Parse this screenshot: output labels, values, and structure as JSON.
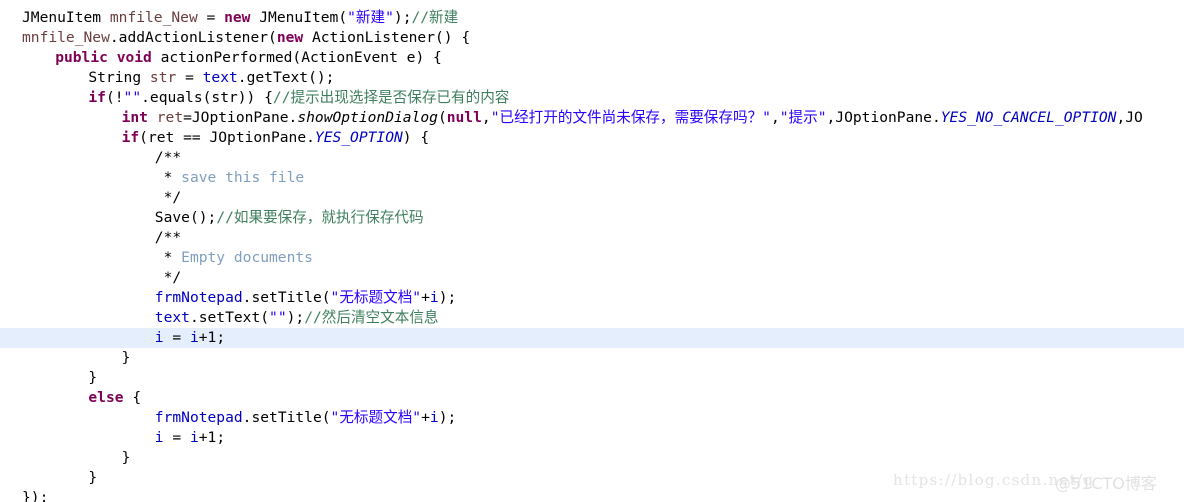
{
  "editor": {
    "language": "Java",
    "background_color": "#ffffff",
    "highlight_color": "#e4eefc",
    "font_size_px": 14.6,
    "line_height_px": 20,
    "highlighted_line_index": 16,
    "colors": {
      "plain": "#000000",
      "keyword": "#7f0055",
      "string": "#2a00ff",
      "comment": "#3f7f5f",
      "javadoc": "#3f5fbf",
      "javadoc_keyword": "#7f9fbf",
      "field": "#0000c0",
      "static_field": "#0000c0",
      "local_variable": "#6a3e3e"
    },
    "lines": [
      {
        "indent": 0,
        "tokens": [
          {
            "t": "JMenuItem ",
            "c": "plain"
          },
          {
            "t": "mnfile_New ",
            "c": "local"
          },
          {
            "t": "= ",
            "c": "plain"
          },
          {
            "t": "new ",
            "c": "keyword"
          },
          {
            "t": "JMenuItem(",
            "c": "plain"
          },
          {
            "t": "\"新建\"",
            "c": "string"
          },
          {
            "t": ");",
            "c": "plain"
          },
          {
            "t": "//新建",
            "c": "comment"
          }
        ]
      },
      {
        "indent": 0,
        "tokens": [
          {
            "t": "mnfile_New",
            "c": "local"
          },
          {
            "t": ".addActionListener(",
            "c": "plain"
          },
          {
            "t": "new ",
            "c": "keyword"
          },
          {
            "t": "ActionListener() {",
            "c": "plain"
          }
        ]
      },
      {
        "indent": 1,
        "tokens": [
          {
            "t": "public ",
            "c": "keyword"
          },
          {
            "t": "void ",
            "c": "keyword"
          },
          {
            "t": "actionPerformed(ActionEvent e) {",
            "c": "plain"
          }
        ]
      },
      {
        "indent": 2,
        "tokens": [
          {
            "t": "String ",
            "c": "plain"
          },
          {
            "t": "str ",
            "c": "local"
          },
          {
            "t": "= ",
            "c": "plain"
          },
          {
            "t": "text",
            "c": "field"
          },
          {
            "t": ".getText();",
            "c": "plain"
          }
        ]
      },
      {
        "indent": 2,
        "tokens": [
          {
            "t": "if",
            "c": "keyword"
          },
          {
            "t": "(!",
            "c": "plain"
          },
          {
            "t": "\"\"",
            "c": "string"
          },
          {
            "t": ".equals(str)) {",
            "c": "plain"
          },
          {
            "t": "//提示出现选择是否保存已有的内容",
            "c": "comment"
          }
        ]
      },
      {
        "indent": 3,
        "tokens": [
          {
            "t": "int ",
            "c": "keyword"
          },
          {
            "t": "ret",
            "c": "local"
          },
          {
            "t": "=JOptionPane.",
            "c": "plain"
          },
          {
            "t": "showOptionDialog",
            "c": "method"
          },
          {
            "t": "(",
            "c": "plain"
          },
          {
            "t": "null",
            "c": "keyword"
          },
          {
            "t": ",",
            "c": "plain"
          },
          {
            "t": "\"已经打开的文件尚未保存，需要保存吗？\"",
            "c": "string"
          },
          {
            "t": ",",
            "c": "plain"
          },
          {
            "t": "\"提示\"",
            "c": "string"
          },
          {
            "t": ",JOptionPane.",
            "c": "plain"
          },
          {
            "t": "YES_NO_CANCEL_OPTION",
            "c": "static"
          },
          {
            "t": ",JO",
            "c": "plain"
          }
        ]
      },
      {
        "indent": 3,
        "tokens": [
          {
            "t": "if",
            "c": "keyword"
          },
          {
            "t": "(ret == JOptionPane.",
            "c": "plain"
          },
          {
            "t": "YES_OPTION",
            "c": "static"
          },
          {
            "t": ") {",
            "c": "plain"
          }
        ]
      },
      {
        "indent": 4,
        "tokens": [
          {
            "t": "/**",
            "c": "javadoc"
          }
        ]
      },
      {
        "indent": 4,
        "tokens": [
          {
            "t": " * ",
            "c": "javadoc"
          },
          {
            "t": "save this file",
            "c": "jdoc-kw"
          }
        ]
      },
      {
        "indent": 4,
        "tokens": [
          {
            "t": " */",
            "c": "javadoc"
          }
        ]
      },
      {
        "indent": 4,
        "tokens": [
          {
            "t": "Save();",
            "c": "plain"
          },
          {
            "t": "//如果要保存，就执行保存代码",
            "c": "comment"
          }
        ]
      },
      {
        "indent": 4,
        "tokens": [
          {
            "t": "/**",
            "c": "javadoc"
          }
        ]
      },
      {
        "indent": 4,
        "tokens": [
          {
            "t": " * ",
            "c": "javadoc"
          },
          {
            "t": "Empty documents",
            "c": "jdoc-kw"
          }
        ]
      },
      {
        "indent": 4,
        "tokens": [
          {
            "t": " */",
            "c": "javadoc"
          }
        ]
      },
      {
        "indent": 4,
        "tokens": [
          {
            "t": "frmNotepad",
            "c": "field"
          },
          {
            "t": ".setTitle(",
            "c": "plain"
          },
          {
            "t": "\"无标题文档\"",
            "c": "string"
          },
          {
            "t": "+",
            "c": "plain"
          },
          {
            "t": "i",
            "c": "field"
          },
          {
            "t": ");",
            "c": "plain"
          }
        ]
      },
      {
        "indent": 4,
        "tokens": [
          {
            "t": "text",
            "c": "field"
          },
          {
            "t": ".setText(",
            "c": "plain"
          },
          {
            "t": "\"\"",
            "c": "string"
          },
          {
            "t": ");",
            "c": "plain"
          },
          {
            "t": "//然后清空文本信息",
            "c": "comment"
          }
        ]
      },
      {
        "indent": 4,
        "tokens": [
          {
            "t": "i ",
            "c": "field"
          },
          {
            "t": "= ",
            "c": "plain"
          },
          {
            "t": "i",
            "c": "field"
          },
          {
            "t": "+1;",
            "c": "plain"
          }
        ]
      },
      {
        "indent": 3,
        "tokens": [
          {
            "t": "}",
            "c": "plain"
          }
        ]
      },
      {
        "indent": 2,
        "tokens": [
          {
            "t": "}",
            "c": "plain"
          }
        ]
      },
      {
        "indent": 2,
        "tokens": [
          {
            "t": "else ",
            "c": "keyword"
          },
          {
            "t": "{",
            "c": "plain"
          }
        ]
      },
      {
        "indent": 4,
        "tokens": [
          {
            "t": "frmNotepad",
            "c": "field"
          },
          {
            "t": ".setTitle(",
            "c": "plain"
          },
          {
            "t": "\"无标题文档\"",
            "c": "string"
          },
          {
            "t": "+",
            "c": "plain"
          },
          {
            "t": "i",
            "c": "field"
          },
          {
            "t": ");",
            "c": "plain"
          }
        ]
      },
      {
        "indent": 4,
        "tokens": [
          {
            "t": "i ",
            "c": "field"
          },
          {
            "t": "= ",
            "c": "plain"
          },
          {
            "t": "i",
            "c": "field"
          },
          {
            "t": "+1;",
            "c": "plain"
          }
        ]
      },
      {
        "indent": 3,
        "tokens": [
          {
            "t": "}",
            "c": "plain"
          }
        ]
      },
      {
        "indent": 2,
        "tokens": [
          {
            "t": "}",
            "c": "plain"
          }
        ]
      },
      {
        "indent": 0,
        "tokens": [
          {
            "t": "});",
            "c": "plain"
          }
        ]
      }
    ]
  },
  "watermarks": {
    "csdn": "https://blog.csdn.net/q",
    "cto": "@51CTO博客"
  }
}
